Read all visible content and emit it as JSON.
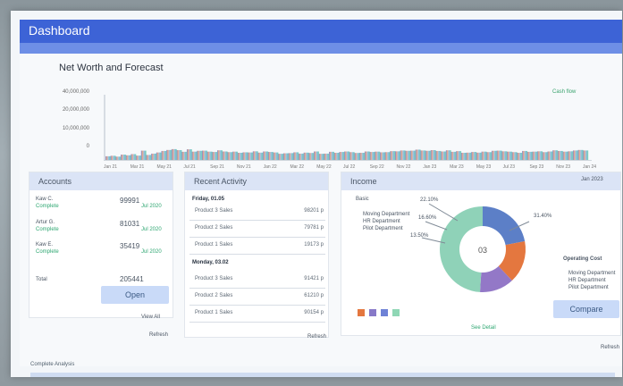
{
  "app": {
    "title": "Dashboard"
  },
  "nav": {
    "items": [
      "",
      "",
      "",
      ""
    ]
  },
  "net_worth": {
    "title": "Net Worth and Forecast",
    "legend": "Cash flow",
    "ylabels": [
      "40,000,000",
      "20,000,000",
      "10,000,000",
      "0"
    ],
    "xlabels": [
      "Jan 21",
      "Mar 21",
      "May 21",
      "Jul 21",
      "Sep 21",
      "Nov 21",
      "Jan 22",
      "Mar 22",
      "May 22",
      "Jul 22",
      "Sep 22",
      "Nov 22",
      "Jan 23",
      "Mar 23",
      "May 23",
      "Jul 23",
      "Sep 23",
      "Nov 23",
      "Jan 24"
    ]
  },
  "chart_data": {
    "type": "bar",
    "title": "Net Worth and Forecast",
    "xlabel": "",
    "ylabel": "",
    "ylim": [
      0,
      40000000
    ],
    "values": [
      2200000,
      2500000,
      2000000,
      3200000,
      2800000,
      3500000,
      2600000,
      5600000,
      3000000,
      3800000,
      4500000,
      5400000,
      6000000,
      6500000,
      5900000,
      4900000,
      6400000,
      5000000,
      5500000,
      5600000,
      5000000,
      4800000,
      5800000,
      5100000,
      4700000,
      5000000,
      4300000,
      4600000,
      4500000,
      5200000,
      4400000,
      5100000,
      4800000,
      4500000,
      3700000,
      4000000,
      4100000,
      4600000,
      3800000,
      4400000,
      4200000,
      5100000,
      3700000,
      3800000,
      4900000,
      4300000,
      4800000,
      5100000,
      4700000,
      4200000,
      4300000,
      5100000,
      4800000,
      5000000,
      4600000,
      4700000,
      5300000,
      5200000,
      5700000,
      5500000,
      5600000,
      6200000,
      5700000,
      5500000,
      5900000,
      5400000,
      5100000,
      5800000,
      4900000,
      5300000,
      4300000,
      4400000,
      4800000,
      4400000,
      5000000,
      4700000,
      5500000,
      5600000,
      5200000,
      5000000,
      4700000,
      4300000,
      5400000,
      4900000,
      5000000,
      5200000,
      4700000,
      5100000,
      5800000,
      5400000,
      5000000,
      5200000,
      5700000,
      6000000,
      5700000
    ]
  },
  "accounts": {
    "title": "Accounts",
    "items": [
      {
        "name": "Kaw C.",
        "sub": "Complete",
        "value": "99991",
        "value_sub": "Jul 2020"
      },
      {
        "name": "Artur G.",
        "sub": "Complete",
        "value": "81031",
        "value_sub": "Jul 2020"
      },
      {
        "name": "Kaw E.",
        "sub": "Complete",
        "value": "35419",
        "value_sub": "Jul 2020"
      }
    ],
    "total_label": "Total",
    "total_value": "205441",
    "button": "Open",
    "footer_a": "View All",
    "footer_b": "Refresh"
  },
  "recent_activity": {
    "title": "Recent Activity",
    "groups": [
      {
        "date": "Friday, 01.05",
        "rows": [
          {
            "label": "Product 3 Sales",
            "value": "98201 p"
          },
          {
            "label": "Product 2 Sales",
            "value": "79781 p"
          },
          {
            "label": "Product 1 Sales",
            "value": "19173 p"
          }
        ]
      },
      {
        "date": "Monday, 03.02",
        "rows": [
          {
            "label": "Product 3 Sales",
            "value": "91421 p"
          },
          {
            "label": "Product 2 Sales",
            "value": "61210 p"
          },
          {
            "label": "Product 1 Sales",
            "value": "90154 p"
          }
        ]
      }
    ],
    "footer": "Refresh"
  },
  "income": {
    "title": "Income",
    "date": "Jan 2023",
    "center": "03",
    "labels": [
      "Basic",
      "Moving Department",
      "HR Department",
      "Pilot Department"
    ],
    "right_title": "Operating Cost",
    "right_items": [
      "Moving Department",
      "HR Department",
      "Pilot Department"
    ],
    "callouts": [
      "22.10%",
      "16.60%",
      "13.50%",
      "31.40%"
    ],
    "button": "Compare",
    "footer": "Refresh",
    "bottom_note": "See Detail"
  },
  "pie": {
    "values": [
      22,
      16,
      13,
      49
    ],
    "colors": [
      "#5c7fc7",
      "#e4773f",
      "#9378c7",
      "#8fd2b8"
    ],
    "legend_colors": [
      "#e4773f",
      "#8779c8",
      "#6e82d6",
      "#8fd7b5"
    ]
  },
  "footer": {
    "left": "Complete Analysis"
  }
}
